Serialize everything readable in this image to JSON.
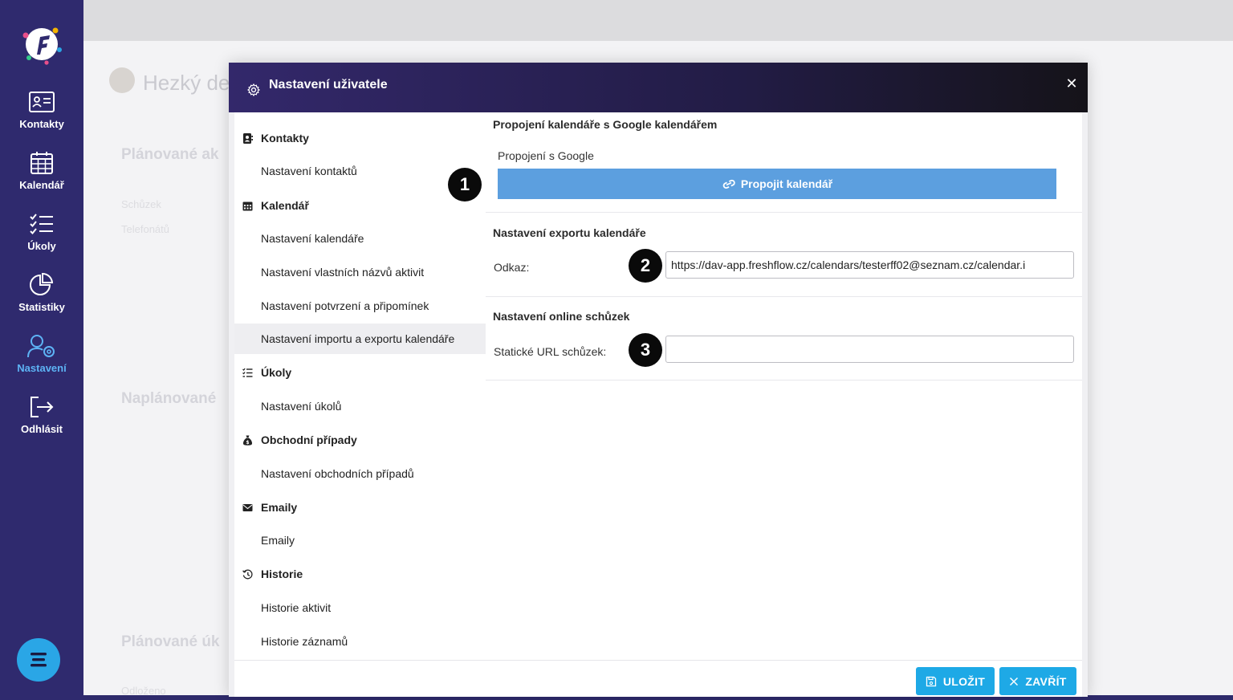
{
  "sidebar": {
    "items": [
      {
        "label": "Kontakty",
        "icon": "contacts-card-icon"
      },
      {
        "label": "Kalendář",
        "icon": "calendar-icon"
      },
      {
        "label": "Úkoly",
        "icon": "task-list-icon"
      },
      {
        "label": "Statistiky",
        "icon": "pie-chart-icon"
      },
      {
        "label": "Nastavení",
        "icon": "user-settings-icon"
      },
      {
        "label": "Odhlásit",
        "icon": "logout-icon"
      }
    ],
    "active_color": "#5db3f5"
  },
  "background": {
    "greeting": "Hezký de",
    "heading_planned_activities": "Plánované ak",
    "row_meetings": "Schůzek",
    "row_calls": "Telefonátů",
    "heading_scheduled": "Naplánované",
    "heading_planned_tasks": "Plánované úk",
    "row_postponed": "Odloženo"
  },
  "modal": {
    "title": "Nastavení uživatele",
    "close_symbol": "✕",
    "menu": {
      "contacts": {
        "title": "Kontakty",
        "items": [
          "Nastavení kontaktů"
        ]
      },
      "calendar": {
        "title": "Kalendář",
        "items": [
          "Nastavení kalendáře",
          "Nastavení vlastních názvů aktivit",
          "Nastavení potvrzení a připomínek",
          "Nastavení importu a exportu kalendáře"
        ]
      },
      "tasks": {
        "title": "Úkoly",
        "items": [
          "Nastavení úkolů"
        ]
      },
      "deals": {
        "title": "Obchodní případy",
        "items": [
          "Nastavení obchodních případů"
        ]
      },
      "emails": {
        "title": "Emaily",
        "items": [
          "Emaily"
        ]
      },
      "history": {
        "title": "Historie",
        "items": [
          "Historie aktivit",
          "Historie záznamů"
        ]
      }
    },
    "content": {
      "google": {
        "section_title": "Propojení kalendáře s Google kalendářem",
        "label": "Propojení s Google",
        "button": "Propojit kalendář"
      },
      "export": {
        "section_title": "Nastavení exportu kalendáře",
        "label": "Odkaz:",
        "value": "https://dav-app.freshflow.cz/calendars/testerff02@seznam.cz/calendar.i"
      },
      "online": {
        "section_title": "Nastavení online schůzek",
        "label": "Statické URL schůzek:",
        "value": ""
      }
    },
    "footer": {
      "save": "ULOŽIT",
      "close": "ZAVŘÍT"
    }
  },
  "badges": [
    "1",
    "2",
    "3"
  ],
  "colors": {
    "sidebar_bg": "#2f2a6e",
    "accent_button": "#1ea9e6",
    "google_button": "#5c9fdf"
  }
}
